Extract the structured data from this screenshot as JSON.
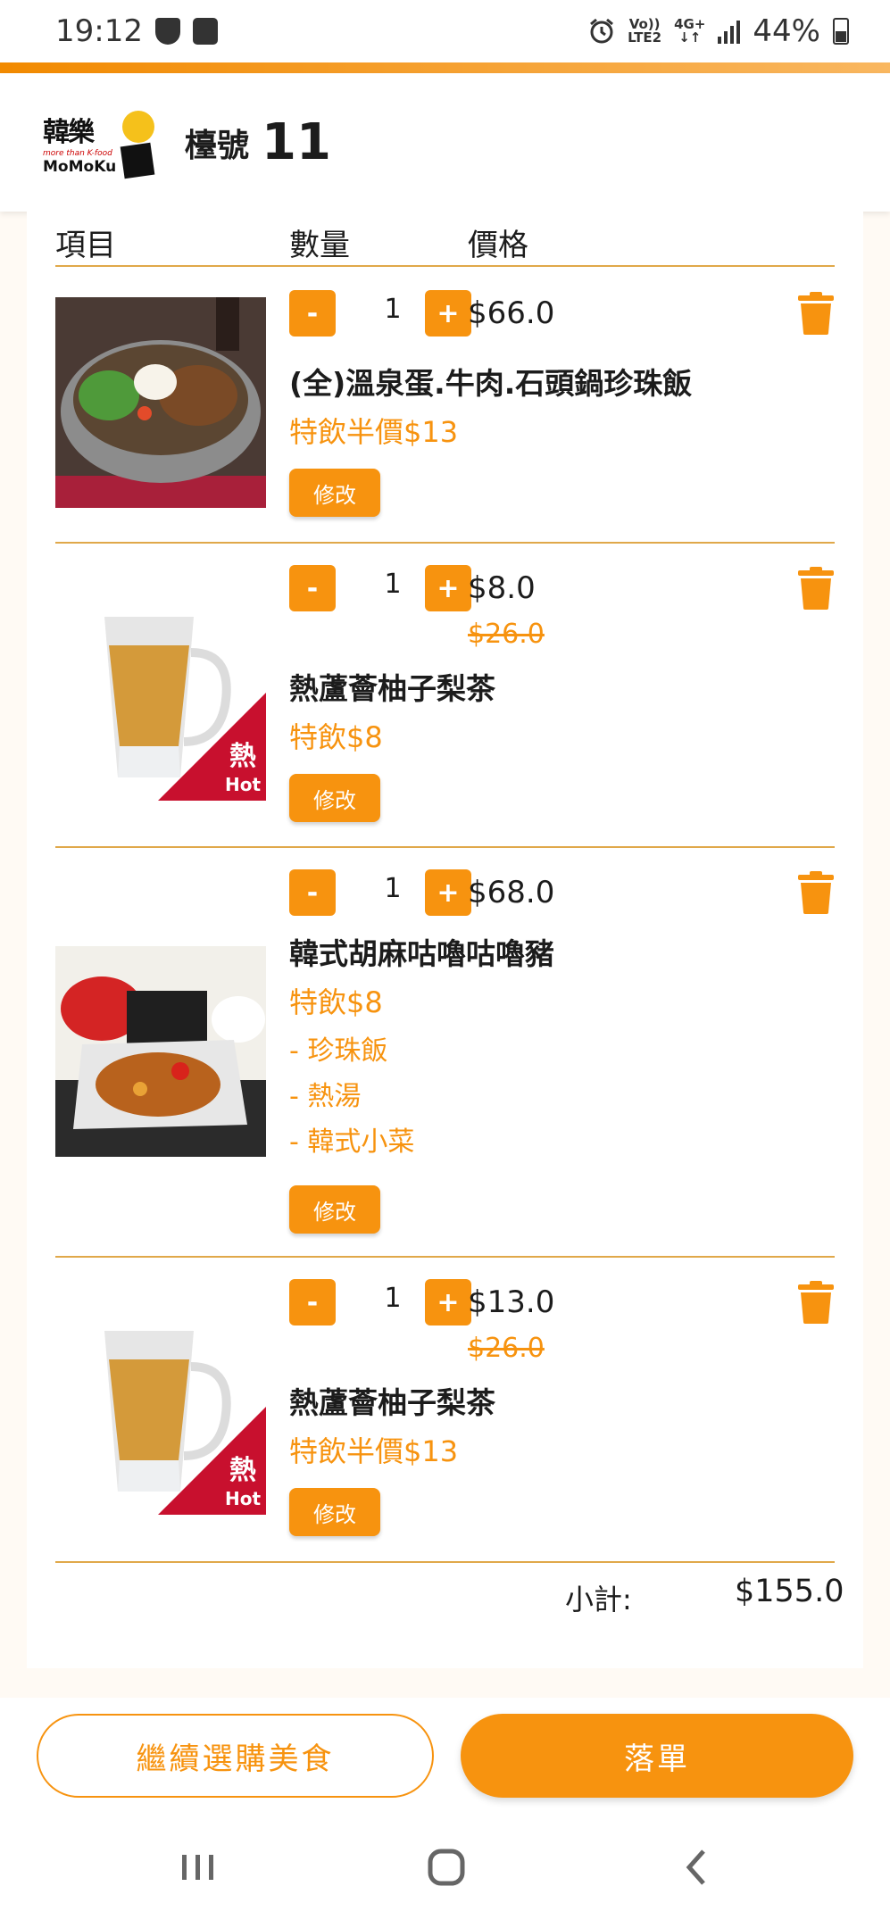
{
  "status_bar": {
    "time": "19:12",
    "network_top": "Vo))",
    "network_bottom": "LTE2",
    "network_type": "4G+",
    "battery": "44%",
    "icons": [
      "shield-icon",
      "clock-app-icon",
      "alarm-icon",
      "signal-icon",
      "battery-icon"
    ]
  },
  "header": {
    "logo_text_kr": "韓樂",
    "logo_small": "more than K-food",
    "logo_text_en": "MoMoKu",
    "table_label": "檯號",
    "table_number": "11"
  },
  "columns": {
    "item": "項目",
    "quantity": "數量",
    "price": "價格"
  },
  "items": [
    {
      "image": "stone-pot-bibimbap-photo",
      "quantity": "1",
      "price": "$66.0",
      "name": "(全)溫泉蛋.牛肉.石頭鍋珍珠飯",
      "promo": "特飲半價$13",
      "edit_label": "修改"
    },
    {
      "image": "hot-aloe-yuzu-pear-tea-photo",
      "badge_zh": "熱",
      "badge_en": "Hot",
      "quantity": "1",
      "price": "$8.0",
      "old_price": "$26.0",
      "name": "熱蘆薈柚子梨茶",
      "promo": "特飲$8",
      "edit_label": "修改"
    },
    {
      "image": "sesame-sweet-sour-pork-set-photo",
      "quantity": "1",
      "price": "$68.0",
      "name": "韓式胡麻咕嚕咕嚕豬",
      "promo": "特飲$8",
      "sides": [
        "- 珍珠飯",
        "- 熱湯",
        "- 韓式小菜"
      ],
      "edit_label": "修改"
    },
    {
      "image": "hot-aloe-yuzu-pear-tea-photo",
      "badge_zh": "熱",
      "badge_en": "Hot",
      "quantity": "1",
      "price": "$13.0",
      "old_price": "$26.0",
      "name": "熱蘆薈柚子梨茶",
      "promo": "特飲半價$13",
      "edit_label": "修改"
    }
  ],
  "qty_minus": "-",
  "qty_plus": "+",
  "subtotal": {
    "label": "小計:",
    "value": "$155.0"
  },
  "actions": {
    "continue": "繼續選購美食",
    "order": "落單"
  },
  "colors": {
    "accent": "#f7930f",
    "divider": "#e0a84a",
    "badge_red": "#c8102e"
  }
}
